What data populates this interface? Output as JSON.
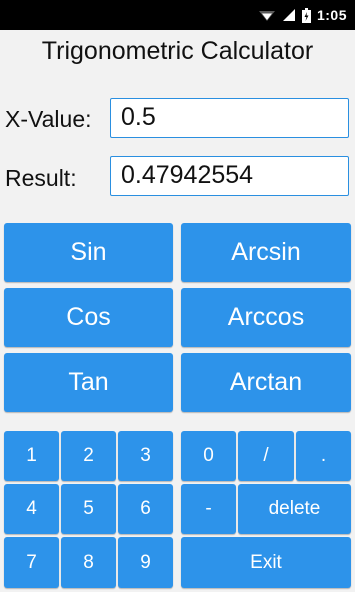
{
  "status_bar": {
    "time": "1:05",
    "icons": [
      "wifi-icon",
      "signal-icon",
      "battery-icon"
    ]
  },
  "app": {
    "title": "Trigonometric Calculator"
  },
  "fields": {
    "x_label": "X-Value:",
    "x_value": "0.5",
    "result_label": "Result:",
    "result_value": "0.47942554"
  },
  "functions": {
    "sin": "Sin",
    "arcsin": "Arcsin",
    "cos": "Cos",
    "arccos": "Arccos",
    "tan": "Tan",
    "arctan": "Arctan"
  },
  "keypad": {
    "k1": "1",
    "k2": "2",
    "k3": "3",
    "k4": "4",
    "k5": "5",
    "k6": "6",
    "k7": "7",
    "k8": "8",
    "k9": "9",
    "k0": "0",
    "slash": "/",
    "dot": ".",
    "minus": "-",
    "delete": "delete",
    "exit": "Exit"
  },
  "colors": {
    "button": "#2d93ea",
    "field_border": "#2a8fe0",
    "background": "#f2f2f2"
  }
}
